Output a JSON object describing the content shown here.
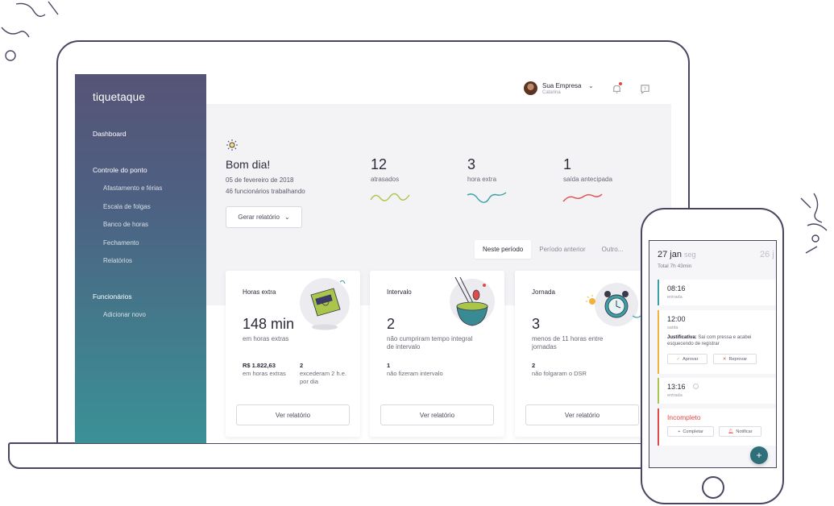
{
  "sidebar": {
    "logo": "tiquetaque",
    "dashboard": "Dashboard",
    "section_ponto": "Controle do ponto",
    "ponto_items": [
      "Afastamento e férias",
      "Escala de folgas",
      "Banco de horas",
      "Fechamento",
      "Relatórios"
    ],
    "section_funcionarios": "Funcionários",
    "funcionarios_items": [
      "Adicionar novo"
    ]
  },
  "topbar": {
    "company": "Sua Empresa",
    "user": "Catarina",
    "notification_icon": "bell-icon",
    "help_icon": "chat-icon"
  },
  "header": {
    "greeting": "Bom dia!",
    "date": "05 de fevereiro de 2018",
    "working": "46 funcionários trabalhando",
    "report_button": "Gerar relatório"
  },
  "stats": [
    {
      "value": "12",
      "label": "atrasados",
      "color": "#a9c54a"
    },
    {
      "value": "3",
      "label": "hora extra",
      "color": "#3aa0a8"
    },
    {
      "value": "1",
      "label": "saída antecipada",
      "color": "#e04a4a"
    }
  ],
  "tabs": [
    "Neste período",
    "Período anterior",
    "Outro..."
  ],
  "cards": [
    {
      "title": "Horas extra",
      "big": "148 min",
      "desc": "em horas extras",
      "sub1_value": "R$ 1.822,63",
      "sub1_text": "em horas extras",
      "sub2_value": "2",
      "sub2_text": "excederam 2 h.e. por dia",
      "button": "Ver relatório"
    },
    {
      "title": "Intervalo",
      "big": "2",
      "desc": "não cumpriram tempo integral de intervalo",
      "sub1_value": "1",
      "sub1_text": "não fizeram intervalo",
      "button": "Ver relatório"
    },
    {
      "title": "Jornada",
      "big": "3",
      "desc": "menos de 11 horas entre jornadas",
      "sub1_value": "2",
      "sub1_text": "não folgaram o DSR",
      "button": "Ver relatório"
    }
  ],
  "phone": {
    "date": "27 jan",
    "weekday": "seg",
    "next_date": "26 j",
    "total": "Total 7h 43min",
    "entries": [
      {
        "time": "08:16",
        "label": "entrada",
        "color": "#3aa0a8"
      },
      {
        "time": "12:00",
        "label": "saída",
        "color": "#f0b23a",
        "justification_label": "Justificativa:",
        "justification_text": "Saí com pressa e acabei esquecendo de registrar",
        "approve": "Aprovar",
        "reject": "Reprovar"
      },
      {
        "time": "13:16",
        "label": "entrada",
        "color": "#a9c54a"
      },
      {
        "status": "Incompleto",
        "color": "#e04a4a",
        "complete": "Completar",
        "notify": "Notificar"
      }
    ],
    "fab": "+"
  }
}
